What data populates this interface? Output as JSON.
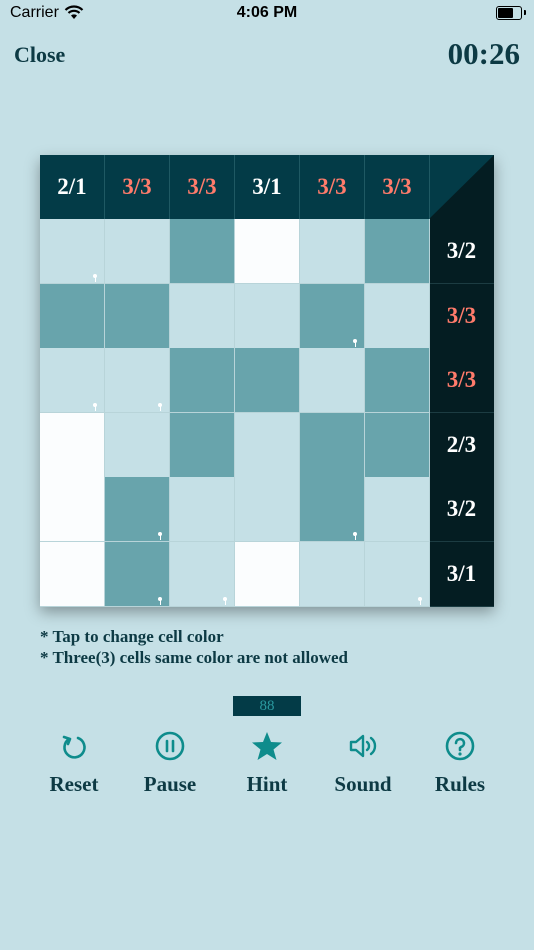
{
  "status": {
    "carrier": "Carrier",
    "time": "4:06 PM"
  },
  "header": {
    "close_label": "Close",
    "timer": "00:26"
  },
  "colors": {
    "dark": "#033b47",
    "light": "#c5e0e6",
    "white": "#fbfdfe",
    "teal": "#68a4ac",
    "conflict": "#ff7b6b",
    "ok": "#ffffff"
  },
  "board": {
    "column_headers": [
      {
        "text": "2/1",
        "conflict": false
      },
      {
        "text": "3/3",
        "conflict": true
      },
      {
        "text": "3/3",
        "conflict": true
      },
      {
        "text": "3/1",
        "conflict": false
      },
      {
        "text": "3/3",
        "conflict": true
      },
      {
        "text": "3/3",
        "conflict": true
      }
    ],
    "row_headers": [
      {
        "text": "3/2",
        "conflict": false
      },
      {
        "text": "3/3",
        "conflict": true
      },
      {
        "text": "3/3",
        "conflict": true
      },
      {
        "text": "2/3",
        "conflict": false
      },
      {
        "text": "3/2",
        "conflict": false
      },
      {
        "text": "3/1",
        "conflict": false
      }
    ],
    "cells": [
      [
        "light",
        "light",
        "teal",
        "white",
        "light",
        "teal"
      ],
      [
        "teal",
        "teal",
        "light",
        "light",
        "teal",
        "light"
      ],
      [
        "light",
        "light",
        "teal",
        "teal",
        "light",
        "teal"
      ],
      [
        "white",
        "light",
        "teal",
        "light",
        "teal",
        "teal"
      ],
      [
        "white",
        "teal",
        "light",
        "light",
        "teal",
        "light"
      ],
      [
        "white",
        "teal",
        "light",
        "white",
        "light",
        "light"
      ]
    ],
    "pins": [
      [
        true,
        false,
        false,
        false,
        false,
        false
      ],
      [
        false,
        false,
        false,
        false,
        true,
        false
      ],
      [
        true,
        true,
        false,
        false,
        false,
        false
      ],
      [
        false,
        false,
        false,
        false,
        false,
        false
      ],
      [
        false,
        true,
        false,
        false,
        true,
        false
      ],
      [
        false,
        true,
        true,
        false,
        false,
        true
      ]
    ]
  },
  "instructions": {
    "line1": "* Tap to change cell color",
    "line2": "* Three(3) cells same color are not allowed"
  },
  "counter": "88",
  "toolbar": [
    {
      "label": "Reset",
      "icon": "reset-icon"
    },
    {
      "label": "Pause",
      "icon": "pause-icon"
    },
    {
      "label": "Hint",
      "icon": "star-icon"
    },
    {
      "label": "Sound",
      "icon": "speaker-icon"
    },
    {
      "label": "Rules",
      "icon": "question-icon"
    }
  ]
}
